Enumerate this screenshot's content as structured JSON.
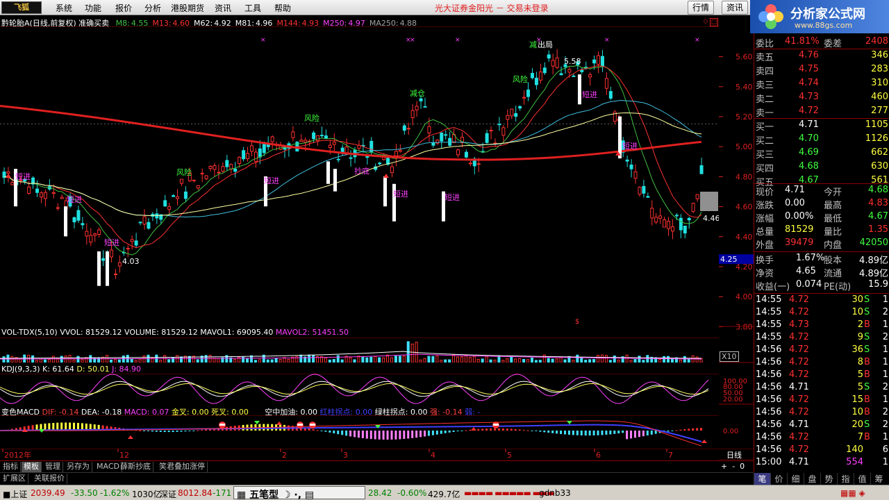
{
  "menu": {
    "logo": "飞狐",
    "items": [
      "系统",
      "功能",
      "报价",
      "分析",
      "港股期货",
      "资讯",
      "工具",
      "帮助"
    ],
    "broker_title": "光大证券金阳光 － 交易未登录",
    "btn_quote": "行情",
    "btn_news": "资讯"
  },
  "site": {
    "name": "分析家公式网",
    "url": "www.88gs.com"
  },
  "main": {
    "stock": "黔轮胎A",
    "period": "(日线,前复权)",
    "formula": "准确买卖",
    "ma": [
      {
        "label": "M8:",
        "value": "4.55",
        "color": "#40c040"
      },
      {
        "label": "M13:",
        "value": "4.60",
        "color": "#ff3030"
      },
      {
        "label": "M62:",
        "value": "4.92",
        "color": "#ffffff"
      },
      {
        "label": "M81:",
        "value": "4.96",
        "color": "#ffffff"
      },
      {
        "label": "M144:",
        "value": "4.93",
        "color": "#ff3030"
      },
      {
        "label": "M250:",
        "value": "4.97",
        "color": "#ff40ff"
      },
      {
        "label": "MA250:",
        "value": "4.88",
        "color": "#a0a0a0"
      }
    ],
    "price_ticks": [
      "5.60",
      "5.40",
      "5.20",
      "5.00",
      "4.80",
      "4.60",
      "4.40",
      "4.20",
      "4.00",
      "3.80"
    ],
    "current_price_box": "4.25",
    "high_label": "5.58",
    "low_label": "4.03",
    "last_label": "4.46",
    "signals": {
      "risk": "风险",
      "cut": "减仓",
      "exit": "出局",
      "short": "短进",
      "gold": "金",
      "fund": "抄底",
      "reduce": "减"
    }
  },
  "vol": {
    "title": "VOL-TDX(5,10)",
    "vvol": "VVOL: 81529.12",
    "volume": "VOLUME: 81529.12",
    "mavol1": "MAVOL1: 69095.40",
    "mavol2": "MAVOL2: 51451.50",
    "unit": "X10"
  },
  "kdj": {
    "title": "KDJ(9,3,3)",
    "k": "K: 61.64",
    "d": "D: 50.01",
    "j": "J: 84.90",
    "ticks": [
      "100.00",
      "80.00",
      "50.00",
      "20.00"
    ]
  },
  "macd": {
    "title": "变色MACD",
    "dif": "DIF: -0.14",
    "dea": "DEA: -0.18",
    "macd": "MACD: 0.07",
    "jin": "金叉: 0.00",
    "si": "死叉: 0.00",
    "kong": "空中加油: 0.00",
    "hong": "红柱拐点: 0.00",
    "lv": "绿柱拐点: 0.00",
    "qiang": "强: -0.14",
    "ruo": "弱: -",
    "tick": "0.00"
  },
  "xaxis": {
    "labels": [
      "2012年",
      "12",
      "2",
      "3",
      "4",
      "5",
      "6",
      "7"
    ],
    "period": "日线"
  },
  "tabs": [
    "指标",
    "模板",
    "管理",
    "另存为",
    "MACD",
    "薛斯抄底",
    "笑君叠加涨停"
  ],
  "tabs2": [
    "扩展区",
    "关联报价"
  ],
  "quote": {
    "ratio_label": "委比",
    "ratio": "41.81%",
    "diff_label": "委差",
    "diff": "2408",
    "sells": [
      {
        "l": "卖五",
        "p": "4.76",
        "v": "346"
      },
      {
        "l": "卖四",
        "p": "4.75",
        "v": "283"
      },
      {
        "l": "卖三",
        "p": "4.74",
        "v": "310"
      },
      {
        "l": "卖二",
        "p": "4.73",
        "v": "460"
      },
      {
        "l": "卖一",
        "p": "4.72",
        "v": "277"
      }
    ],
    "buys": [
      {
        "l": "买一",
        "p": "4.71",
        "v": "1105"
      },
      {
        "l": "买二",
        "p": "4.70",
        "v": "1126"
      },
      {
        "l": "买三",
        "p": "4.69",
        "v": "662"
      },
      {
        "l": "买四",
        "p": "4.68",
        "v": "630"
      },
      {
        "l": "买五",
        "p": "4.67",
        "v": "561"
      }
    ],
    "stats": [
      {
        "a": "现价",
        "b": "4.71",
        "c": "今开",
        "d": "4.68"
      },
      {
        "a": "涨跌",
        "b": "0.00",
        "c": "最高",
        "d": "4.83"
      },
      {
        "a": "涨幅",
        "b": "0.00%",
        "c": "最低",
        "d": "4.67"
      },
      {
        "a": "总量",
        "b": "81529",
        "c": "量比",
        "d": "1.35"
      },
      {
        "a": "外盘",
        "b": "39479",
        "c": "内盘",
        "d": "42050"
      }
    ],
    "stats2": [
      {
        "a": "换手",
        "b": "1.67%",
        "c": "股本",
        "d": "4.89亿"
      },
      {
        "a": "净资",
        "b": "4.65",
        "c": "流通",
        "d": "4.89亿"
      },
      {
        "a": "收益(一)",
        "b": "0.074",
        "c": "PE(动)",
        "d": "15.9"
      }
    ],
    "ticks": [
      {
        "t": "14:55",
        "p": "4.72",
        "v": "30",
        "s": "S",
        "n": "1"
      },
      {
        "t": "14:55",
        "p": "4.72",
        "v": "10",
        "s": "S",
        "n": "2"
      },
      {
        "t": "14:55",
        "p": "4.73",
        "v": "2",
        "s": "B",
        "n": "1"
      },
      {
        "t": "14:55",
        "p": "4.72",
        "v": "9",
        "s": "S",
        "n": "2"
      },
      {
        "t": "14:56",
        "p": "4.72",
        "v": "36",
        "s": "S",
        "n": "1"
      },
      {
        "t": "14:56",
        "p": "4.72",
        "v": "8",
        "s": "B",
        "n": "1"
      },
      {
        "t": "14:56",
        "p": "4.72",
        "v": "5",
        "s": "B",
        "n": "1"
      },
      {
        "t": "14:56",
        "p": "4.71",
        "v": "5",
        "s": "S",
        "n": "2"
      },
      {
        "t": "14:56",
        "p": "4.72",
        "v": "15",
        "s": "B",
        "n": "1"
      },
      {
        "t": "14:56",
        "p": "4.72",
        "v": "10",
        "s": "B",
        "n": "2"
      },
      {
        "t": "14:56",
        "p": "4.71",
        "v": "20",
        "s": "S",
        "n": "2"
      },
      {
        "t": "14:56",
        "p": "4.72",
        "v": "7",
        "s": "B",
        "n": "1"
      },
      {
        "t": "14:56",
        "p": "4.72",
        "v": "140",
        "s": "",
        "n": "6"
      },
      {
        "t": "15:00",
        "p": "4.71",
        "v": "554",
        "s": "",
        "n": "1"
      }
    ]
  },
  "rtabs": [
    "笔",
    "价",
    "细",
    "盘",
    "势",
    "指",
    "值",
    "筹"
  ],
  "status": {
    "sh_label": "上证",
    "sh": "2039.49",
    "sh_chg": "-33.50",
    "sh_pct": "-1.62%",
    "sh_amt": "1030亿",
    "sz_label": "深证",
    "sz": "8012.84",
    "sz_chg": "-171",
    "ime": "五笔型",
    "idx2": "28.42",
    "idx2pct": "-0.60%",
    "amt2": "429.7亿",
    "user": "gdnb33"
  },
  "colors": {
    "up": "#ff3030",
    "down": "#00e0e0",
    "green": "#20c020",
    "grid": "#8b0000"
  }
}
